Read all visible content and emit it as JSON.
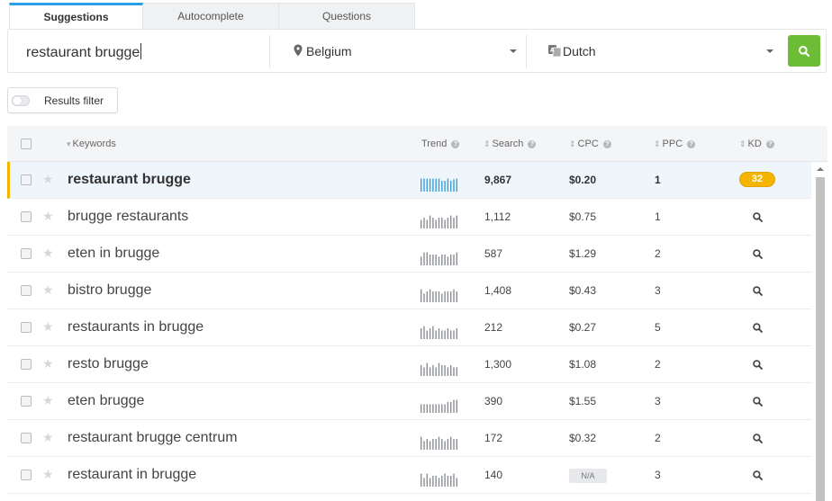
{
  "tabs": [
    {
      "label": "Suggestions",
      "active": true
    },
    {
      "label": "Autocomplete",
      "active": false
    },
    {
      "label": "Questions",
      "active": false
    }
  ],
  "search": {
    "query": "restaurant brugge",
    "location": "Belgium",
    "language": "Dutch",
    "button_icon": "search-icon"
  },
  "filter": {
    "label": "Results filter",
    "enabled": false
  },
  "table": {
    "headers": {
      "keywords": "Keywords",
      "trend": "Trend",
      "search": "Search",
      "cpc": "CPC",
      "ppc": "PPC",
      "kd": "KD"
    },
    "rows": [
      {
        "keyword": "restaurant brugge",
        "search": "9,867",
        "cpc": "$0.20",
        "ppc": "1",
        "kd": "32",
        "trend": [
          0.9,
          0.9,
          0.9,
          0.9,
          0.9,
          0.9,
          0.9,
          0.75,
          0.75,
          0.9,
          0.75,
          0.85,
          0.9
        ],
        "highlight": true
      },
      {
        "keyword": "brugge restaurants",
        "search": "1,112",
        "cpc": "$0.75",
        "ppc": "1",
        "kd": "",
        "trend": [
          0.6,
          0.75,
          0.6,
          0.9,
          0.75,
          0.6,
          0.75,
          0.75,
          0.6,
          0.75,
          0.9,
          0.75,
          0.9
        ]
      },
      {
        "keyword": "eten in brugge",
        "search": "587",
        "cpc": "$1.29",
        "ppc": "2",
        "kd": "",
        "trend": [
          0.6,
          0.9,
          0.9,
          0.75,
          0.75,
          0.75,
          0.6,
          0.75,
          0.75,
          0.6,
          0.75,
          0.75,
          0.9
        ]
      },
      {
        "keyword": "bistro brugge",
        "search": "1,408",
        "cpc": "$0.43",
        "ppc": "3",
        "kd": "",
        "trend": [
          0.9,
          0.6,
          0.75,
          0.9,
          0.75,
          0.75,
          0.75,
          0.6,
          0.75,
          0.75,
          0.75,
          0.9,
          0.75
        ]
      },
      {
        "keyword": "restaurants in brugge",
        "search": "212",
        "cpc": "$0.27",
        "ppc": "5",
        "kd": "",
        "trend": [
          0.75,
          0.9,
          0.6,
          0.75,
          0.9,
          0.6,
          0.75,
          0.6,
          0.6,
          0.75,
          0.6,
          0.6,
          0.75
        ]
      },
      {
        "keyword": "resto brugge",
        "search": "1,300",
        "cpc": "$1.08",
        "ppc": "2",
        "kd": "",
        "trend": [
          0.75,
          0.6,
          0.9,
          0.6,
          0.75,
          0.6,
          0.9,
          0.75,
          0.75,
          0.6,
          0.75,
          0.6,
          0.6
        ]
      },
      {
        "keyword": "eten brugge",
        "search": "390",
        "cpc": "$1.55",
        "ppc": "3",
        "kd": "",
        "trend": [
          0.6,
          0.6,
          0.6,
          0.6,
          0.6,
          0.6,
          0.6,
          0.6,
          0.6,
          0.75,
          0.75,
          0.9,
          0.9
        ]
      },
      {
        "keyword": "restaurant brugge centrum",
        "search": "172",
        "cpc": "$0.32",
        "ppc": "2",
        "kd": "",
        "trend": [
          0.9,
          0.6,
          0.75,
          0.6,
          0.75,
          0.75,
          0.9,
          0.75,
          0.6,
          0.75,
          0.9,
          0.75,
          0.75
        ]
      },
      {
        "keyword": "restaurant in brugge",
        "search": "140",
        "cpc": "N/A",
        "ppc": "3",
        "kd": "",
        "trend": [
          0.9,
          0.6,
          0.9,
          0.6,
          0.75,
          0.75,
          0.6,
          0.75,
          0.9,
          0.75,
          0.75,
          0.9,
          0.6
        ]
      }
    ]
  },
  "colors": {
    "accent_blue": "#29a0e6",
    "search_button_green": "#6cbd35",
    "kd_badge_orange": "#f4b400",
    "highlight_row": "#eef5fb",
    "trend_highlight": "#3a9fd8",
    "trend_normal": "#8a8e93"
  }
}
